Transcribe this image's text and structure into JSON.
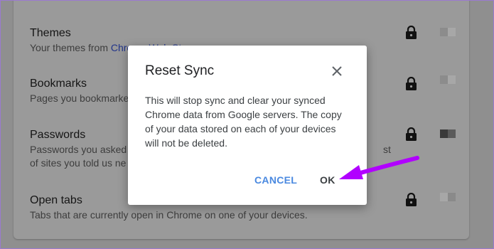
{
  "settings_rows": [
    {
      "title": "Themes",
      "desc_prefix": "Your themes from ",
      "desc_link": "Chrome Web Store",
      "desc_line2": ""
    },
    {
      "title": "Bookmarks",
      "desc_prefix": "Pages you bookmarke",
      "desc_link": "",
      "desc_line2": ""
    },
    {
      "title": "Passwords",
      "desc_prefix": "Passwords you asked",
      "desc_link": "",
      "desc_line2": "of sites you told us ne"
    },
    {
      "title": "Open tabs",
      "desc_prefix": "Tabs that are currently open in Chrome on one of your devices.",
      "desc_link": "",
      "desc_line2": ""
    }
  ],
  "passwords_right_fragment": "st",
  "dialog": {
    "title": "Reset Sync",
    "body": "This will stop sync and clear your synced\nChrome data from Google servers. The copy\nof your data stored on each of your devices\nwill not be deleted.",
    "cancel_label": "CANCEL",
    "ok_label": "OK"
  },
  "icons": {
    "lock": "lock-icon",
    "close": "close-icon",
    "annotation": "arrow-annotation"
  },
  "colors": {
    "accent_blue": "#4a89e0",
    "arrow_purple": "#b100ff",
    "frame_purple": "#9b7ad0"
  }
}
